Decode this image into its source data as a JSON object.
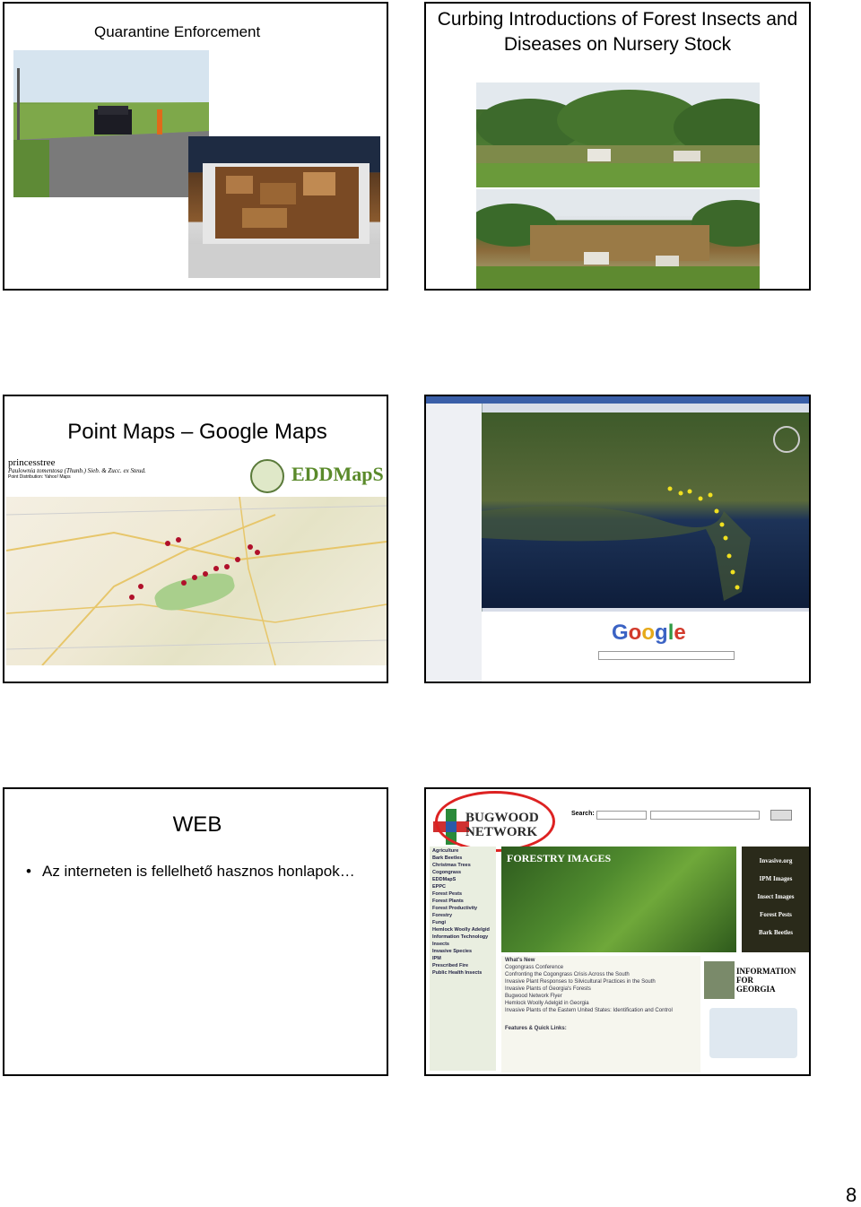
{
  "slides": {
    "s1": {
      "title": "Quarantine Enforcement"
    },
    "s2": {
      "title": "Curbing Introductions of Forest Insects and Diseases on Nursery Stock"
    },
    "s3": {
      "title": "Point Maps – Google Maps",
      "screenshot": {
        "site_title": "princesstree",
        "species": "Paulownia tomentosa (Thunb.) Sieb. & Zucc. ex Steud.",
        "subtitle": "Point Distribution: Yahoo! Maps",
        "logo": "EDDMapS"
      }
    },
    "s4": {
      "screenshot": {
        "logo_letters": [
          "G",
          "o",
          "o",
          "g",
          "l",
          "e"
        ]
      }
    },
    "s5": {
      "title": "WEB",
      "bullet": "Az interneten is fellelhető hasznos honlapok…"
    },
    "s6": {
      "screenshot": {
        "logo_line1": "BUGWOOD",
        "logo_line2": "NETWORK",
        "search_label": "Search:",
        "hero_title": "FORESTRY IMAGES",
        "right_links": [
          "Invasive.org",
          "IPM Images",
          "Insect Images",
          "Forest Pests",
          "Bark Beetles"
        ],
        "topics": [
          "Agriculture",
          "Bark Beetles",
          "Christmas Trees",
          "Cogongrass",
          "EDDMapS",
          "EPPC",
          "Forest Pests",
          "Forest Plants",
          "Forest Productivity",
          "Forestry",
          "Fungi",
          "Hemlock Woolly Adelgid",
          "Information Technology",
          "Insects",
          "Invasive Species",
          "IPM",
          "Prescribed Fire",
          "Public Health Insects"
        ],
        "news_header": "What's New",
        "news": [
          "Cogongrass Conference",
          "Confronting the Cogongrass Crisis Across the South",
          "Invasive Plant Responses to Silvicultural Practices in the South",
          "Invasive Plants of Georgia's Forests",
          "Bugwood Network Flyer",
          "Hemlock Woolly Adelgid in Georgia",
          "Invasive Plants of the Eastern United States: Identification and Control"
        ],
        "features": "Features & Quick Links:",
        "georgia": [
          "INFORMATION",
          "FOR",
          "GEORGIA"
        ]
      }
    }
  },
  "page_number": "8"
}
